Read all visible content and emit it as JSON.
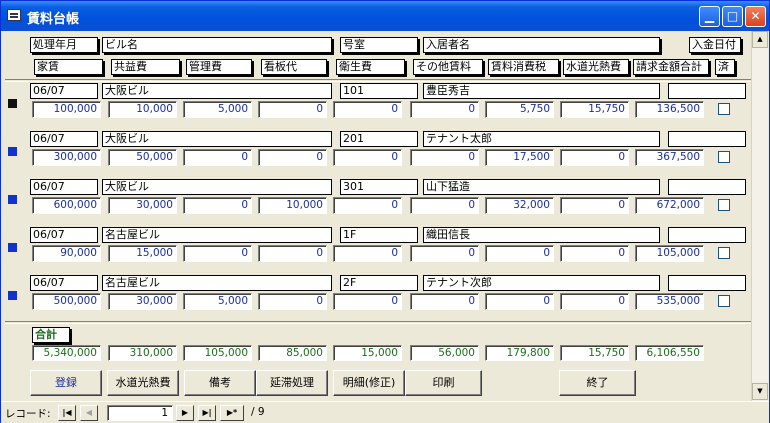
{
  "window": {
    "title": "賃料台帳",
    "icon": "form-icon",
    "controls": [
      "minimize",
      "maximize",
      "close"
    ]
  },
  "header": {
    "row1": {
      "period": "処理年月",
      "building": "ビル名",
      "room": "号室",
      "tenant": "入居者名",
      "paid_date": "入金日付"
    },
    "row2": {
      "rent": "家賃",
      "common": "共益費",
      "management": "管理費",
      "signboard": "看板代",
      "sanitation": "衛生費",
      "other": "その他賃料",
      "tax": "賃料消費税",
      "utility": "水道光熱費",
      "billing": "請求金額合計",
      "done": "済"
    }
  },
  "records": [
    {
      "period": "06/07",
      "building": "大阪ビル",
      "room": "101",
      "tenant": "豊臣秀吉",
      "paid_date": "",
      "values": [
        "100,000",
        "10,000",
        "5,000",
        "0",
        "0",
        "0",
        "5,750",
        "15,750",
        "136,500"
      ],
      "done": false
    },
    {
      "period": "06/07",
      "building": "大阪ビル",
      "room": "201",
      "tenant": "テナント太郎",
      "paid_date": "",
      "values": [
        "300,000",
        "50,000",
        "0",
        "0",
        "0",
        "0",
        "17,500",
        "0",
        "367,500"
      ],
      "done": false
    },
    {
      "period": "06/07",
      "building": "大阪ビル",
      "room": "301",
      "tenant": "山下猛造",
      "paid_date": "",
      "values": [
        "600,000",
        "30,000",
        "0",
        "10,000",
        "0",
        "0",
        "32,000",
        "0",
        "672,000"
      ],
      "done": false
    },
    {
      "period": "06/07",
      "building": "名古屋ビル",
      "room": "1F",
      "tenant": "織田信長",
      "paid_date": "",
      "values": [
        "90,000",
        "15,000",
        "0",
        "0",
        "0",
        "0",
        "0",
        "0",
        "105,000"
      ],
      "done": false
    },
    {
      "period": "06/07",
      "building": "名古屋ビル",
      "room": "2F",
      "tenant": "テナント次郎",
      "paid_date": "",
      "values": [
        "500,000",
        "30,000",
        "5,000",
        "0",
        "0",
        "0",
        "0",
        "0",
        "535,000"
      ],
      "done": false
    }
  ],
  "totals": {
    "label": "合計",
    "values": [
      "5,340,000",
      "310,000",
      "105,000",
      "85,000",
      "15,000",
      "56,000",
      "179,800",
      "15,750",
      "6,106,550"
    ]
  },
  "buttons": {
    "register": "登録",
    "utility": "水道光熱費",
    "notes": "備考",
    "late": "延滞処理",
    "detail": "明細(修正)",
    "print": "印刷",
    "exit": "終了"
  },
  "navigation": {
    "label": "レコード:",
    "current": "1",
    "total": "/ 9",
    "first": "|◀",
    "prev": "◀",
    "next": "▶",
    "last": "▶|",
    "new": "▶*"
  },
  "colors": {
    "titlebar": "#0050dd",
    "number_text": "#1a2ea0",
    "total_text": "#1b6e1b",
    "background": "#ece9d8"
  }
}
